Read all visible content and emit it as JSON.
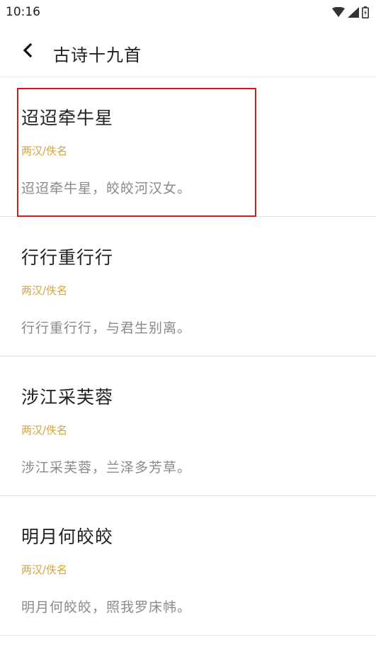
{
  "status_bar": {
    "time": "10:16",
    "icons": [
      "wifi-icon",
      "signal-icon",
      "battery-icon"
    ]
  },
  "app_bar": {
    "back_icon": "chevron-left-icon",
    "title": "古诗十九首"
  },
  "poems": [
    {
      "title": "迢迢牵牛星",
      "author": "两汉/佚名",
      "first_line": "迢迢牵牛星，皎皎河汉女。",
      "highlighted": true
    },
    {
      "title": "行行重行行",
      "author": "两汉/佚名",
      "first_line": "行行重行行，与君生别离。"
    },
    {
      "title": "涉江采芙蓉",
      "author": "两汉/佚名",
      "first_line": "涉江采芙蓉，兰泽多芳草。"
    },
    {
      "title": "明月何皎皎",
      "author": "两汉/佚名",
      "first_line": "明月何皎皎，照我罗床帏。"
    }
  ],
  "colors": {
    "author": "#d4a441",
    "highlight": "#d01919",
    "text": "#222222",
    "secondary_text": "#8a8a8a"
  }
}
